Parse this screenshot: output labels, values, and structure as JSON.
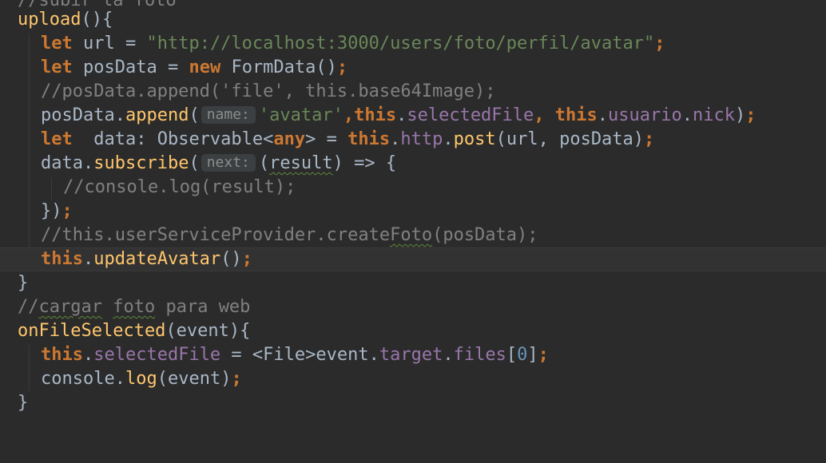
{
  "editor": {
    "colors": {
      "background": "#2b2b2b",
      "keyword": "#cc7832",
      "string": "#6a8759",
      "function": "#ffc66d",
      "field": "#9876aa",
      "number": "#6897bb",
      "comment": "#808080",
      "plain": "#a9b7c6"
    },
    "line0": {
      "comment": "//subir la foto"
    },
    "line1": {
      "method": "upload",
      "rest": "(){"
    },
    "line2": {
      "kw": "let",
      "mid": " url = ",
      "str": "\"http://localhost:3000/users/foto/perfil/avatar\"",
      "semi": ";"
    },
    "line3": {
      "kw": "let",
      "mid": " posData = ",
      "new": "new",
      "rest": " FormData()",
      "semi": ";"
    },
    "line4": {
      "comment": "//posData.append('file', this.base64Image);"
    },
    "line5": {
      "obj": "posData.",
      "method": "append",
      "paren": "(",
      "hint": "name:",
      "str": "'avatar'",
      "comma1": ",",
      "this1": "this",
      "dot1": ".",
      "field1": "selectedFile",
      "comma2": ", ",
      "this2": "this",
      "dot2": ".",
      "field2": "usuario",
      "dot3": ".",
      "field3": "nick",
      "close": ")",
      "semi": ";"
    },
    "line6": {
      "kw": "let",
      "mid": "  data: Observable<",
      "any": "any",
      "mid2": "> = ",
      "this": "this",
      "dot": ".",
      "field": "http",
      "dot2": ".",
      "method": "post",
      "rest": "(url, posData)",
      "semi": ";"
    },
    "line7": {
      "obj": "data.",
      "method": "subscribe",
      "paren": "(",
      "hint": "next:",
      "open": "(",
      "param": "result",
      "rest": ") => {"
    },
    "line8": {
      "comment": "//console.log(result);"
    },
    "line9": {
      "rest": "})",
      "semi": ";"
    },
    "line10": {
      "prefix": "//this.userServiceProvider.create",
      "typo": "Foto",
      "suffix": "(posData);"
    },
    "line11": {
      "this": "this",
      "dot": ".",
      "method": "updateAvatar",
      "rest": "()",
      "semi": ";"
    },
    "line12": {
      "rest": "}"
    },
    "line13": {
      "c1": "//",
      "w1": "cargar",
      "c2": " ",
      "w2": "foto",
      "c3": " para web"
    },
    "line14": {
      "method": "onFileSelected",
      "rest": "(event){"
    },
    "line15": {
      "this": "this",
      "dot": ".",
      "field": "selectedFile",
      "mid": " = <File>event.",
      "field2": "target",
      "dot2": ".",
      "field3": "files",
      "open": "[",
      "num": "0",
      "close": "]",
      "semi": ";"
    },
    "line16": {
      "obj": "console.",
      "method": "log",
      "rest": "(event)",
      "semi": ";"
    },
    "line17": {
      "rest": "}"
    }
  }
}
